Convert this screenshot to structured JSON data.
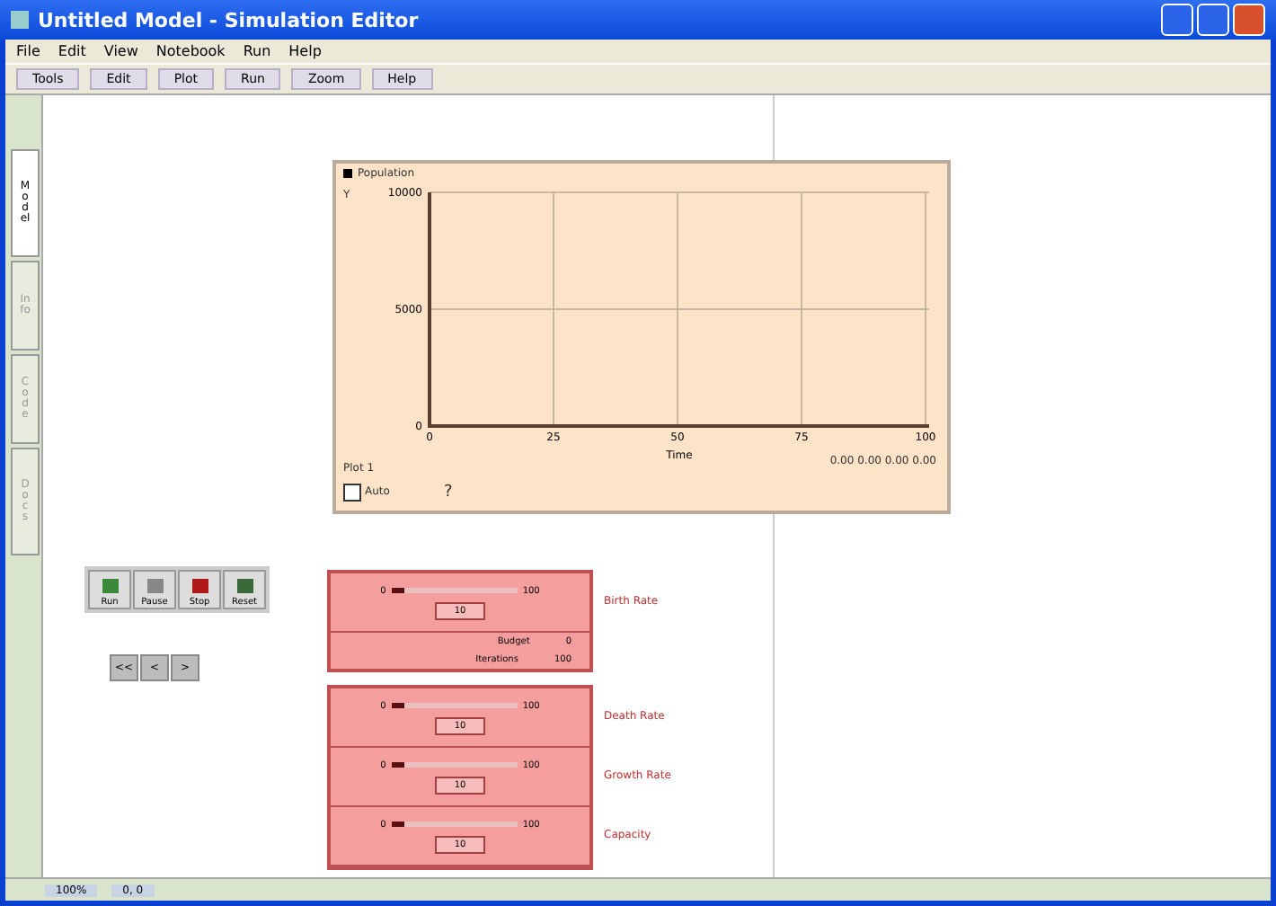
{
  "window": {
    "title": "Untitled Model - Simulation Editor"
  },
  "menu": [
    "File",
    "Edit",
    "View",
    "Notebook",
    "Run",
    "Help"
  ],
  "toolbar": [
    {
      "label": "Tools"
    },
    {
      "label": "Edit"
    },
    {
      "label": "Plot"
    },
    {
      "label": "Run"
    },
    {
      "label": "Zoom"
    },
    {
      "label": "Help"
    }
  ],
  "side_tabs": [
    {
      "label": "Model",
      "selected": true
    },
    {
      "label": "Info",
      "selected": false
    },
    {
      "label": "Code",
      "selected": false
    },
    {
      "label": "Docs",
      "selected": false
    }
  ],
  "plot": {
    "legend": "Population",
    "y_axis_mark": "Y",
    "x_axis_mark": "Plot 1",
    "readout": "0.00 0.00 0.00 0.00",
    "chart_data": {
      "type": "line",
      "xlabel": "Time",
      "categories": [
        "0",
        "25",
        "50",
        "75",
        "100"
      ],
      "yticks": [
        0,
        5000,
        10000
      ],
      "ylim": [
        0,
        10000
      ],
      "grid": true
    },
    "autoscale": {
      "label": "Auto",
      "checked": false
    },
    "help": "?"
  },
  "run_buttons": [
    {
      "label": "Run",
      "color": "#3a8a3a"
    },
    {
      "label": "Pause",
      "color": "#888888"
    },
    {
      "label": "Stop",
      "color": "#b01818"
    },
    {
      "label": "Reset",
      "color": "#3a6a3a"
    }
  ],
  "step_buttons": [
    "<<",
    "<",
    ">"
  ],
  "slider_panels": [
    {
      "sliders": [
        {
          "min": "0",
          "max": "100",
          "level": 0.1,
          "value": "10",
          "label": "Birth Rate"
        }
      ],
      "monitors": [
        {
          "name": "Budget",
          "value": "0"
        },
        {
          "name": "Iterations",
          "value": "100"
        }
      ]
    },
    {
      "sliders": [
        {
          "min": "0",
          "max": "100",
          "level": 0.1,
          "value": "10",
          "label": "Death Rate"
        },
        {
          "min": "0",
          "max": "100",
          "level": 0.1,
          "value": "10",
          "label": "Growth Rate"
        },
        {
          "min": "0",
          "max": "100",
          "level": 0.1,
          "value": "10",
          "label": "Capacity"
        }
      ]
    }
  ],
  "status_bar": {
    "zoom": "100%",
    "position": "0, 0"
  }
}
